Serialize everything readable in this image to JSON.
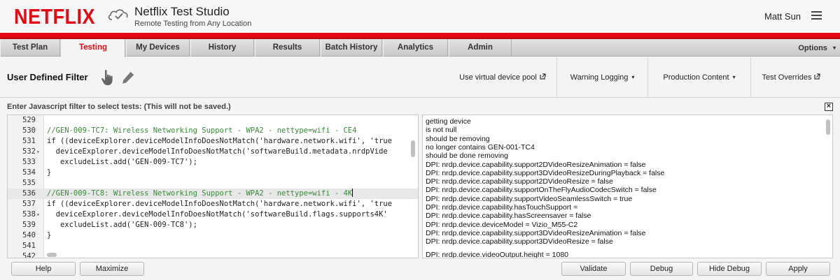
{
  "header": {
    "logo": "NETFLIX",
    "app_title": "Netflix Test Studio",
    "app_subtitle": "Remote Testing from Any Location",
    "user_name": "Matt Sun",
    "brand_color": "#e50914"
  },
  "nav": {
    "tabs": [
      {
        "label": "Test Plan"
      },
      {
        "label": "Testing"
      },
      {
        "label": "My Devices"
      },
      {
        "label": "History"
      },
      {
        "label": "Results"
      },
      {
        "label": "Batch History"
      },
      {
        "label": "Analytics"
      },
      {
        "label": "Admin"
      }
    ],
    "active_tab": "Testing",
    "options_label": "Options"
  },
  "toolbar": {
    "title": "User Defined Filter",
    "virtual_pool": "Use virtual device pool",
    "warning_logging": "Warning Logging",
    "production_content": "Production Content",
    "test_overrides": "Test Overrides"
  },
  "prompt": "Enter Javascript filter to select tests: (This will not be saved.)",
  "editor": {
    "line_numbers": [
      "529",
      "530",
      "531",
      "532",
      "533",
      "534",
      "535",
      "536",
      "537",
      "538",
      "539",
      "540",
      "541",
      "542"
    ],
    "lines": [
      "",
      "//GEN-009-TC7: Wireless Networking Support - WPA2 - nettype=wifi - CE4",
      "if ((deviceExplorer.deviceModelInfoDoesNotMatch('hardware.network.wifi', 'true",
      "  deviceExplorer.deviceModelInfoDoesNotMatch('softwareBuild.metadata.nrdpVide",
      "   excludeList.add('GEN-009-TC7');",
      "}",
      "",
      "//GEN-009-TC8: Wireless Networking Support - WPA2 - nettype=wifi - 4K",
      "if ((deviceExplorer.deviceModelInfoDoesNotMatch('hardware.network.wifi', 'true",
      "  deviceExplorer.deviceModelInfoDoesNotMatch('softwareBuild.flags.supports4K'",
      "   excludeList.add('GEN-009-TC8');",
      "}",
      "",
      ""
    ]
  },
  "log": [
    "getting device",
    "is not null",
    "should be removing",
    "no longer contains GEN-001-TC4",
    "should be done removing",
    "DPI: nrdp.device.capability.support2DVideoResizeAnimation = false",
    "DPI: nrdp.device.capability.support3DVideoResizeDuringPlayback = false",
    "DPI: nrdp.device.capability.support2DVideoResize = false",
    "DPI: nrdp.device.capability.supportOnTheFlyAudioCodecSwitch = false",
    "DPI: nrdp.device.capability.supportVideoSeamlessSwitch = true",
    "DPI: nrdp.device.capability.hasTouchSupport =",
    "DPI: nrdp.device.capability.hasScreensaver = false",
    "DPI: nrdp.device.deviceModel = Vizio_M55-C2",
    "DPI: nrdp.device.capability.support3DVideoResizeAnimation = false",
    "DPI: nrdp.device.capability.support3DVideoResize = false",
    "DPI: nrdp.device.videoOutput.height = 1080"
  ],
  "buttons": {
    "help": "Help",
    "maximize": "Maximize",
    "validate": "Validate",
    "debug": "Debug",
    "hide_debug": "Hide Debug",
    "apply": "Apply"
  }
}
